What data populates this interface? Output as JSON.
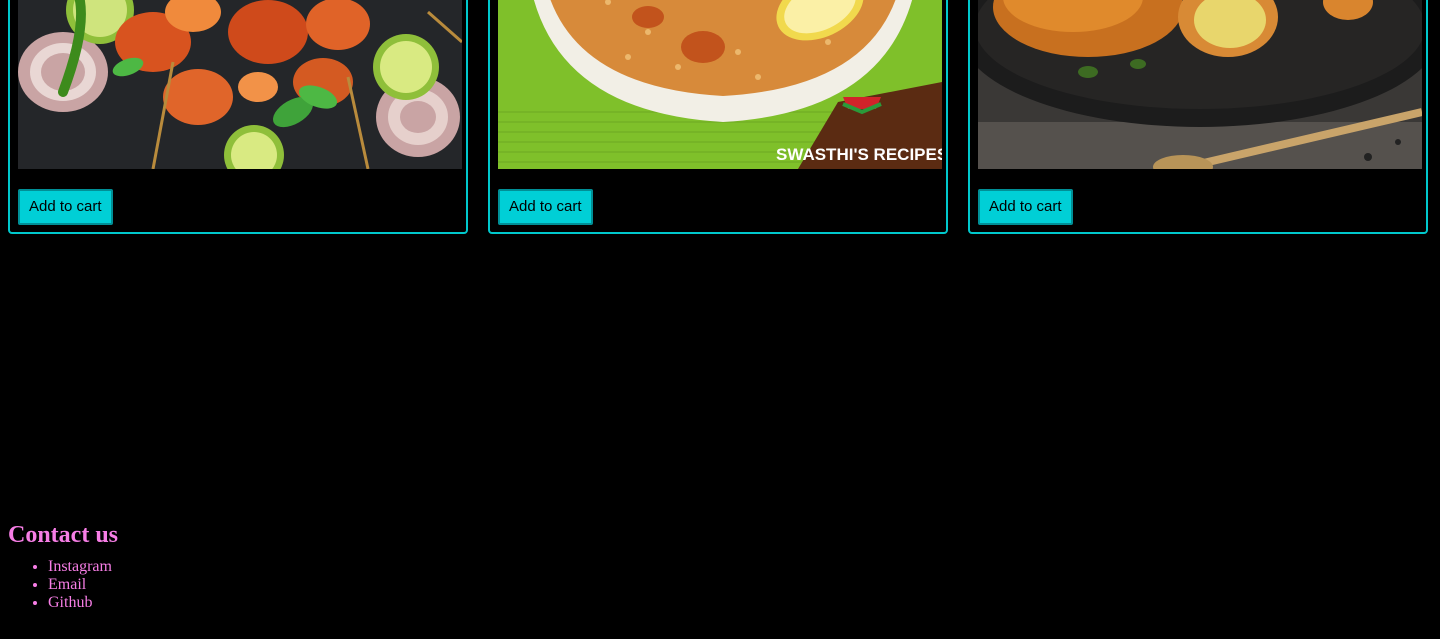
{
  "products": [
    {
      "image_alt": "chicken tikka skewers",
      "cart_label": "Add to cart"
    },
    {
      "image_alt": "biryani bowl",
      "image_watermark": "SWASTHI'S RECIPES",
      "cart_label": "Add to cart"
    },
    {
      "image_alt": "fried stuffed snacks",
      "cart_label": "Add to cart"
    }
  ],
  "footer": {
    "title": "Contact us",
    "links": [
      "Instagram",
      "Email",
      "Github"
    ]
  },
  "colors": {
    "accent": "#00cfd6",
    "card_border": "#00c8cc",
    "footer_text": "#f77ee6",
    "background": "#000000"
  }
}
